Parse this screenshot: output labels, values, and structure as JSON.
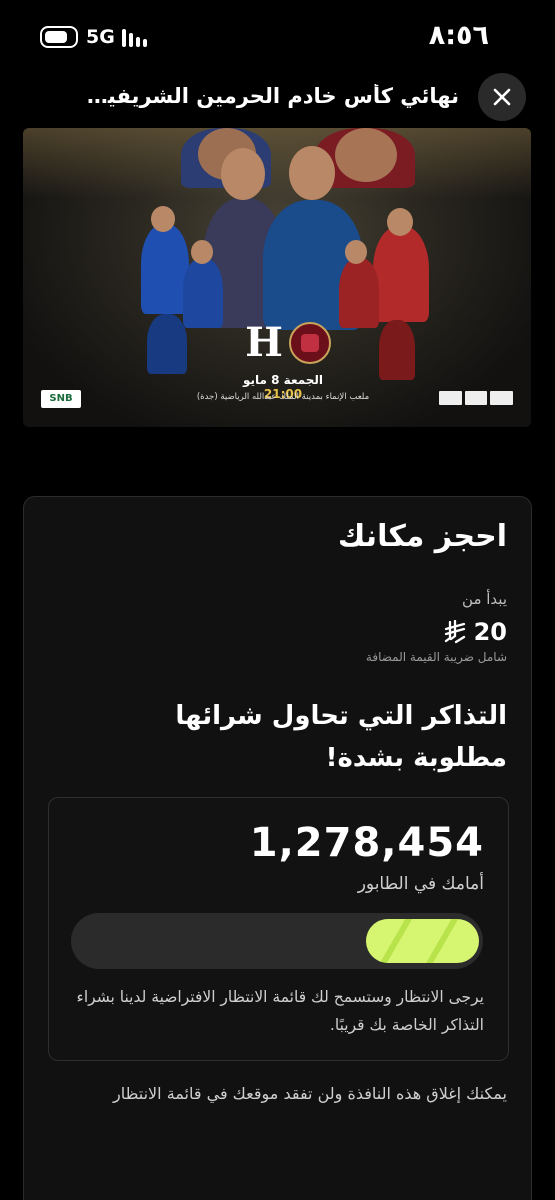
{
  "status_bar": {
    "network": "5G",
    "time": "٨:٥٦"
  },
  "header": {
    "title": "نهائي كأس خادم الحرمين الشريفين - الـ..."
  },
  "banner": {
    "match_date": "الجمعة 8 مايو",
    "match_time": "21:00",
    "venue": "ملعب الإنماء بمدينة الملك عبدالله الرياضية (جدة)",
    "sponsor_logo": "SNB"
  },
  "booking": {
    "title": "احجز مكانك",
    "starts_from": "يبدأ من",
    "price": "20",
    "currency_icon": "saudi-riyal-icon",
    "vat_note": "شامل ضريبة القيمة المضافة",
    "demand_text": "التذاكر التي تحاول شرائها مطلوبة بشدة!"
  },
  "queue": {
    "count": "1,278,454",
    "label": "أمامك في الطابور",
    "progress_fraction": 0.28,
    "info": "يرجى الانتظار وستسمح لك قائمة الانتظار الافتراضية لدينا بشراء التذاكر الخاصة بك قريبًا.",
    "close_note": "يمكنك إغلاق هذه النافذة ولن تفقد موقعك في قائمة الانتظار"
  },
  "colors": {
    "accent": "#d6f571",
    "background": "#000000",
    "card": "#111111"
  }
}
